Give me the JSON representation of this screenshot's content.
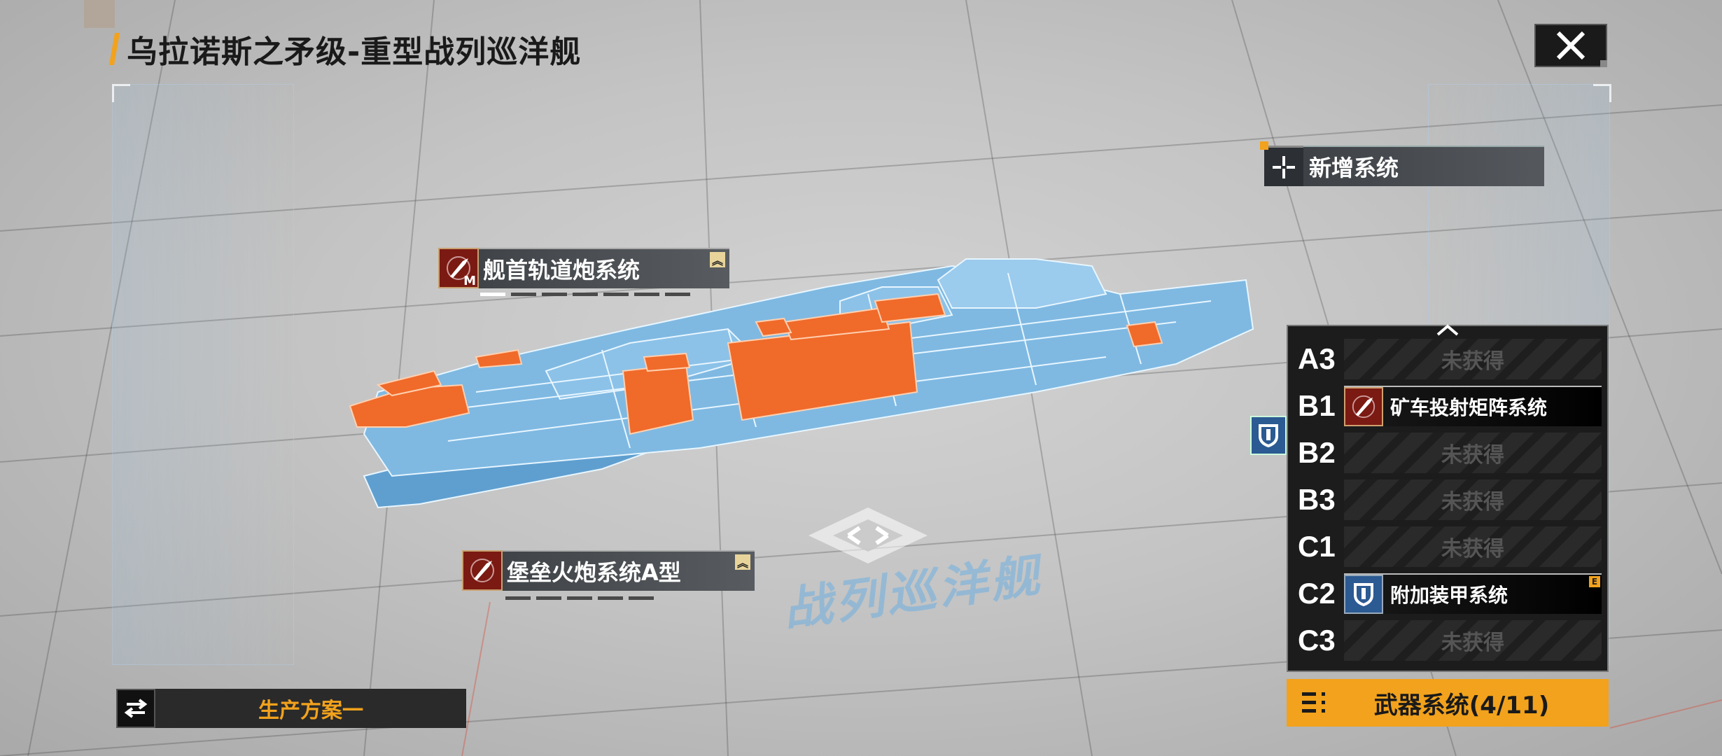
{
  "header": {
    "title": "乌拉诺斯之矛级-重型战列巡洋舰",
    "close_icon": "close-icon"
  },
  "new_system": {
    "label": "新增系统",
    "icon": "plus-crosshair-icon"
  },
  "ship_tags": [
    {
      "label": "舰首轨道炮系统",
      "icon": "missile-icon",
      "badge": "M",
      "upgrade_icon": "chevron-up-icon",
      "level_filled": 1,
      "level_total": 7
    },
    {
      "label": "堡垒火炮系统A型",
      "icon": "missile-icon",
      "upgrade_icon": "chevron-up-icon",
      "level_filled": 0,
      "level_total": 5
    }
  ],
  "watermark": "战列巡洋舰",
  "slots": [
    {
      "code": "A3",
      "status": "未获得",
      "filled": false
    },
    {
      "code": "B1",
      "name": "矿车投射矩阵系统",
      "filled": true,
      "icon": "missile-icon",
      "icon_color": "#7a1a12"
    },
    {
      "code": "B2",
      "status": "未获得",
      "filled": false
    },
    {
      "code": "B3",
      "status": "未获得",
      "filled": false
    },
    {
      "code": "C1",
      "status": "未获得",
      "filled": false
    },
    {
      "code": "C2",
      "name": "附加装甲系统",
      "filled": true,
      "icon": "shield-icon",
      "icon_color": "#2c5a92",
      "tier": "E"
    },
    {
      "code": "C3",
      "status": "未获得",
      "filled": false
    }
  ],
  "weapon_button": {
    "label": "武器系统(4/11)",
    "icon": "list-menu-icon"
  },
  "plan_button": {
    "label": "生产方案一",
    "icon": "swap-arrows-icon"
  },
  "colors": {
    "accent": "#f2a21c",
    "ship_blue": "#7fc4ef",
    "ship_orange": "#f06a2a",
    "dark": "#1c1c1c"
  }
}
